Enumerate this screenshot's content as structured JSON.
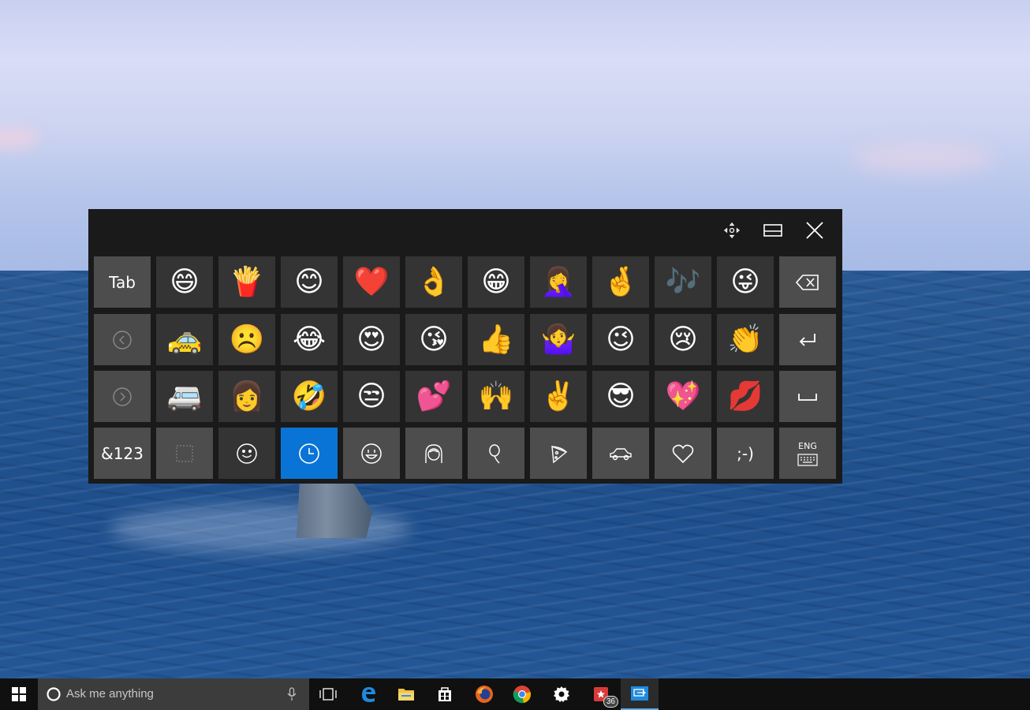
{
  "keyboard": {
    "titlebar": {
      "move_icon": "move-icon",
      "dock_icon": "dock-icon",
      "close_icon": "close-icon"
    },
    "side_keys": {
      "tab": "Tab",
      "prev_page_icon": "chevron-left-circle-icon",
      "next_page_icon": "chevron-right-circle-icon",
      "symbols": "&123",
      "backspace_icon": "backspace-icon",
      "enter_icon": "enter-icon",
      "space_icon": "space-icon",
      "language": "ENG",
      "language_icon": "keyboard-icon"
    },
    "emoji_rows": [
      [
        "😄",
        "🍟",
        "😊",
        "❤️",
        "👌",
        "😁",
        "🤦‍♀️",
        "🤞",
        "🎶",
        "😜"
      ],
      [
        "🚕",
        "☹️",
        "😂",
        "😍",
        "😘",
        "👍",
        "🤷‍♀️",
        "😉",
        "😢",
        "👏"
      ],
      [
        "🚐",
        "👩",
        "🤣",
        "😒",
        "💕",
        "🙌",
        "✌️",
        "😎",
        "💖",
        "💋"
      ]
    ],
    "categories": [
      {
        "name": "category-stamp",
        "icon": "stamp-icon"
      },
      {
        "name": "category-smiley",
        "icon": "smiley-outline-icon"
      },
      {
        "name": "category-recent",
        "icon": "clock-icon",
        "active": true
      },
      {
        "name": "category-faces",
        "icon": "grinning-face-icon"
      },
      {
        "name": "category-people",
        "icon": "person-icon"
      },
      {
        "name": "category-celebration",
        "icon": "balloon-icon"
      },
      {
        "name": "category-food",
        "icon": "pizza-icon"
      },
      {
        "name": "category-travel",
        "icon": "car-icon"
      },
      {
        "name": "category-symbols",
        "icon": "heart-outline-icon"
      }
    ],
    "emoticon_key": ";-)"
  },
  "taskbar": {
    "search_placeholder": "Ask me anything",
    "apps": [
      "task-view-icon",
      "edge-icon",
      "file-explorer-icon",
      "store-icon",
      "firefox-icon",
      "chrome-icon",
      "settings-icon",
      "todo-app-icon",
      "remote-desktop-icon"
    ],
    "badge_count": "36"
  },
  "colors": {
    "accent": "#0a74d6",
    "keyboard_bg": "#1a1a1a",
    "key_bg": "#343434",
    "func_key_bg": "#4d4d4d",
    "taskbar_bg": "#101010"
  }
}
